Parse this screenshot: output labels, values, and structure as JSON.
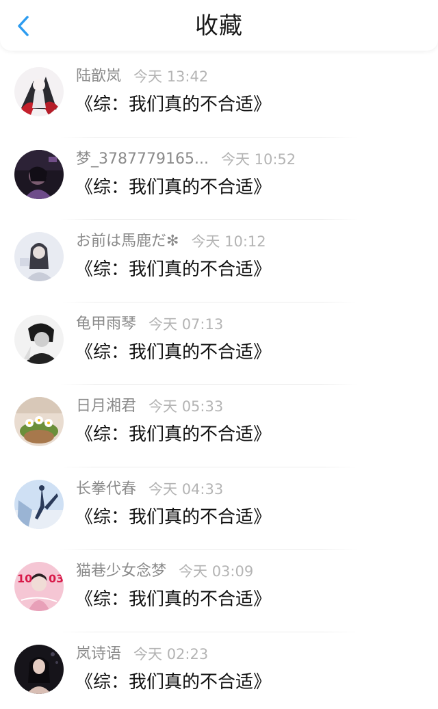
{
  "header": {
    "title": "收藏",
    "back_icon": "chevron-left-icon",
    "accent_color": "#2d9cf0"
  },
  "items": [
    {
      "username": "陆歆岚",
      "time": "今天 13:42",
      "content": "《综：我们真的不合适》"
    },
    {
      "username": "梦_3787779165...",
      "time": "今天 10:52",
      "content": "《综：我们真的不合适》"
    },
    {
      "username": "お前は馬鹿だ✻",
      "time": "今天 10:12",
      "content": "《综：我们真的不合适》"
    },
    {
      "username": "龟甲雨琴",
      "time": "今天 07:13",
      "content": "《综：我们真的不合适》"
    },
    {
      "username": "日月湘君",
      "time": "今天 05:33",
      "content": "《综：我们真的不合适》"
    },
    {
      "username": "长拳代春",
      "time": "今天 04:33",
      "content": "《综：我们真的不合适》"
    },
    {
      "username": "猫巷少女念梦",
      "time": "今天 03:09",
      "content": "《综：我们真的不合适》"
    },
    {
      "username": "岚诗语",
      "time": "今天 02:23",
      "content": "《综：我们真的不合适》"
    }
  ]
}
